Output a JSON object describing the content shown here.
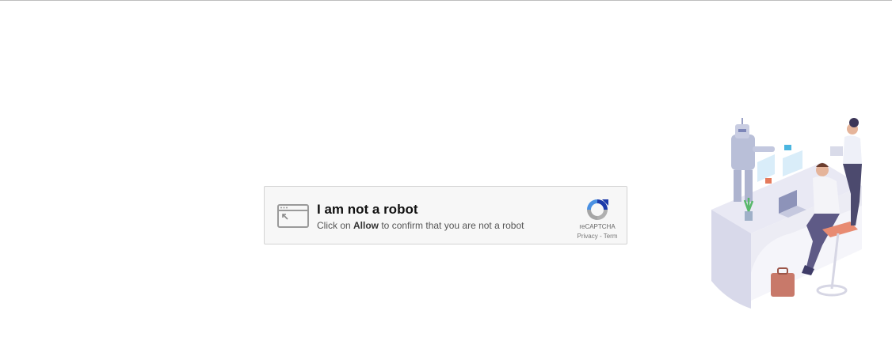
{
  "captcha": {
    "title": "I am not a robot",
    "instruction_prefix": "Click on ",
    "instruction_bold": "Allow",
    "instruction_suffix": " to confirm that you are not a robot",
    "recaptcha_label": "reCAPTCHA",
    "privacy_link": "Privacy",
    "separator": " - ",
    "terms_link": "Term"
  },
  "colors": {
    "box_background": "#f7f7f7",
    "box_border": "#d3d3d3",
    "recaptcha_blue": "#1c3aa9",
    "recaptcha_light_blue": "#4a90e2",
    "recaptcha_gray": "#b0b0b0"
  },
  "icons": {
    "browser": "browser-window-icon",
    "recaptcha": "recaptcha-logo-icon"
  }
}
